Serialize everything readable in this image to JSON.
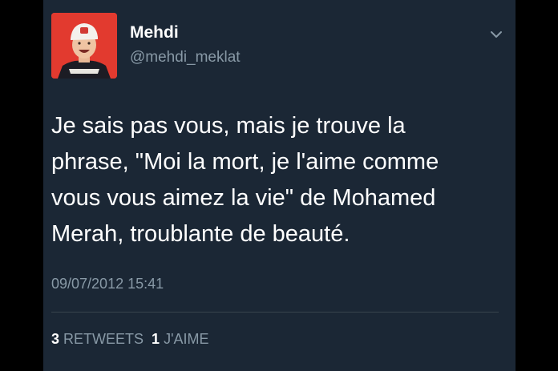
{
  "tweet": {
    "author": {
      "display_name": "Mehdi",
      "handle": "@mehdi_meklat",
      "avatar_icon": "profile-photo"
    },
    "menu_icon": "chevron-down-icon",
    "text_lines": [
      "Je sais pas vous, mais je trouve la",
      "phrase, \"Moi la mort, je l'aime comme",
      "vous vous aimez la vie\" de Mohamed",
      "Merah, troublante de beauté."
    ],
    "timestamp": "09/07/2012 15:41",
    "stats": {
      "retweets_count": "3",
      "retweets_label": "RETWEETS",
      "likes_count": "1",
      "likes_label": "J'AIME"
    }
  },
  "colors": {
    "background": "#1b2735",
    "text": "#ffffff",
    "secondary_text": "#8899a6",
    "avatar_background": "#e23a2f"
  }
}
